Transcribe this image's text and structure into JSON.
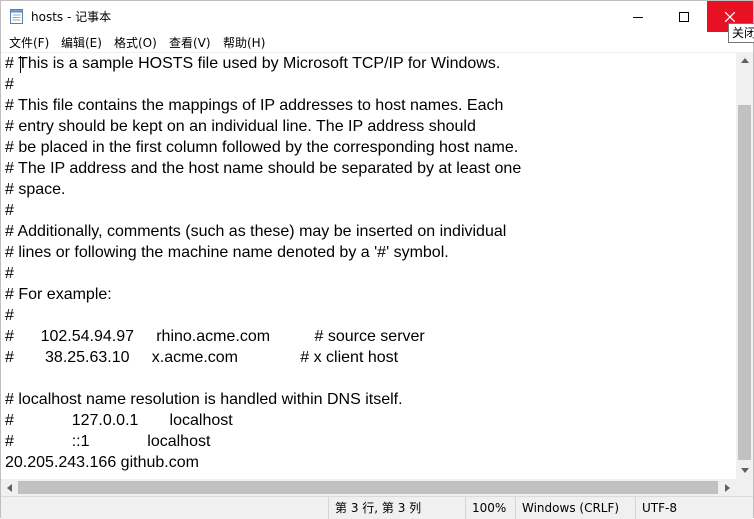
{
  "window": {
    "title": "hosts - 记事本",
    "close_tooltip": "关闭"
  },
  "titlebar": {
    "min_icon": "minimize-icon",
    "max_icon": "maximize-icon",
    "close_icon": "close-icon"
  },
  "menu": [
    "文件(F)",
    "编辑(E)",
    "格式(O)",
    "查看(V)",
    "帮助(H)"
  ],
  "editor": {
    "lines": [
      "# This is a sample HOSTS file used by Microsoft TCP/IP for Windows.",
      "#",
      "# This file contains the mappings of IP addresses to host names. Each",
      "# entry should be kept on an individual line. The IP address should",
      "# be placed in the first column followed by the corresponding host name.",
      "# The IP address and the host name should be separated by at least one",
      "# space.",
      "#",
      "# Additionally, comments (such as these) may be inserted on individual",
      "# lines or following the machine name denoted by a '#' symbol.",
      "#",
      "# For example:",
      "#",
      "#      102.54.94.97     rhino.acme.com          # source server",
      "#       38.25.63.10     x.acme.com              # x client host",
      "",
      "# localhost name resolution is handled within DNS itself.",
      "#             127.0.0.1       localhost",
      "#             ::1             localhost",
      "20.205.243.166 github.com"
    ]
  },
  "status": {
    "position": "第 3 行, 第 3 列",
    "zoom": "100%",
    "line_ending": "Windows (CRLF)",
    "encoding": "UTF-8"
  }
}
